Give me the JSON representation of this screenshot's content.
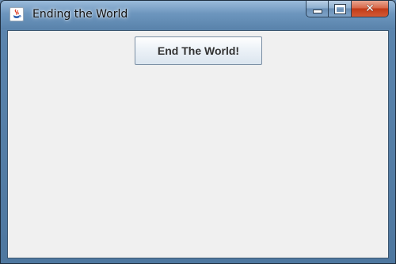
{
  "window": {
    "title": "Ending the World",
    "icon": "java-cup-icon",
    "caption_buttons": {
      "minimize": "minimize-icon",
      "maximize": "maximize-icon",
      "close": "close-icon"
    }
  },
  "content": {
    "end_button_label": "End The World!"
  },
  "colors": {
    "client_background": "#f0f0f0",
    "title_bar": "#5a84ad",
    "close_button": "#c23b18"
  }
}
